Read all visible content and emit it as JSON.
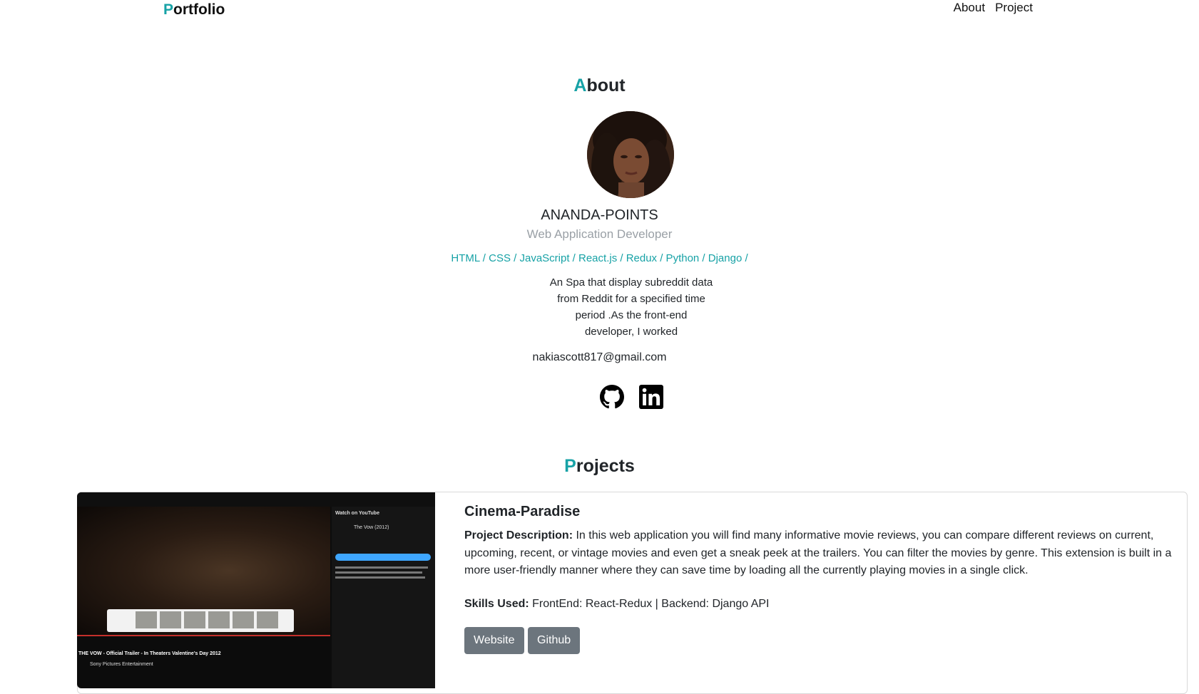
{
  "nav": {
    "brand_first": "P",
    "brand_rest": "ortfolio",
    "links": [
      "About",
      "Project"
    ]
  },
  "about": {
    "title_first": "A",
    "title_rest": "bout",
    "name": "ANANDA-POINTS",
    "role": "Web Application Developer",
    "skills": "HTML / CSS / JavaScript / React.js / Redux / Python / Django /",
    "bio": "An Spa that display subreddit data from Reddit for a specified time period .As the front-end developer, I worked",
    "email": "nakiascott817@gmail.com",
    "social": [
      "github-icon",
      "linkedin-icon"
    ]
  },
  "projects": {
    "title_first": "P",
    "title_rest": "rojects",
    "items": [
      {
        "title": "Cinema-Paradise",
        "desc_label": "Project Description:",
        "desc": "In this web application you will find many informative movie reviews, you can compare different reviews on current, upcoming, recent, or vintage movies and even get a sneak peek at the trailers. You can filter the movies by genre. This extension is built in a more user-friendly manner where they can save time by loading all the currently playing movies in a single click.",
        "skills_label": "Skills Used:",
        "skills": "FrontEnd: React-Redux | Backend: Django API",
        "buttons": [
          "Website",
          "Github"
        ],
        "screenshot": {
          "watch_label": "Watch on YouTube",
          "movie_title": "The Vow (2012)",
          "caption": "THE VOW - Official Trailer - In Theaters Valentine's Day 2012",
          "channel": "Sony Pictures Entertainment"
        }
      }
    ]
  },
  "colors": {
    "accent": "#17a2a6",
    "button": "#6c757d",
    "muted": "#9aa0a6"
  }
}
